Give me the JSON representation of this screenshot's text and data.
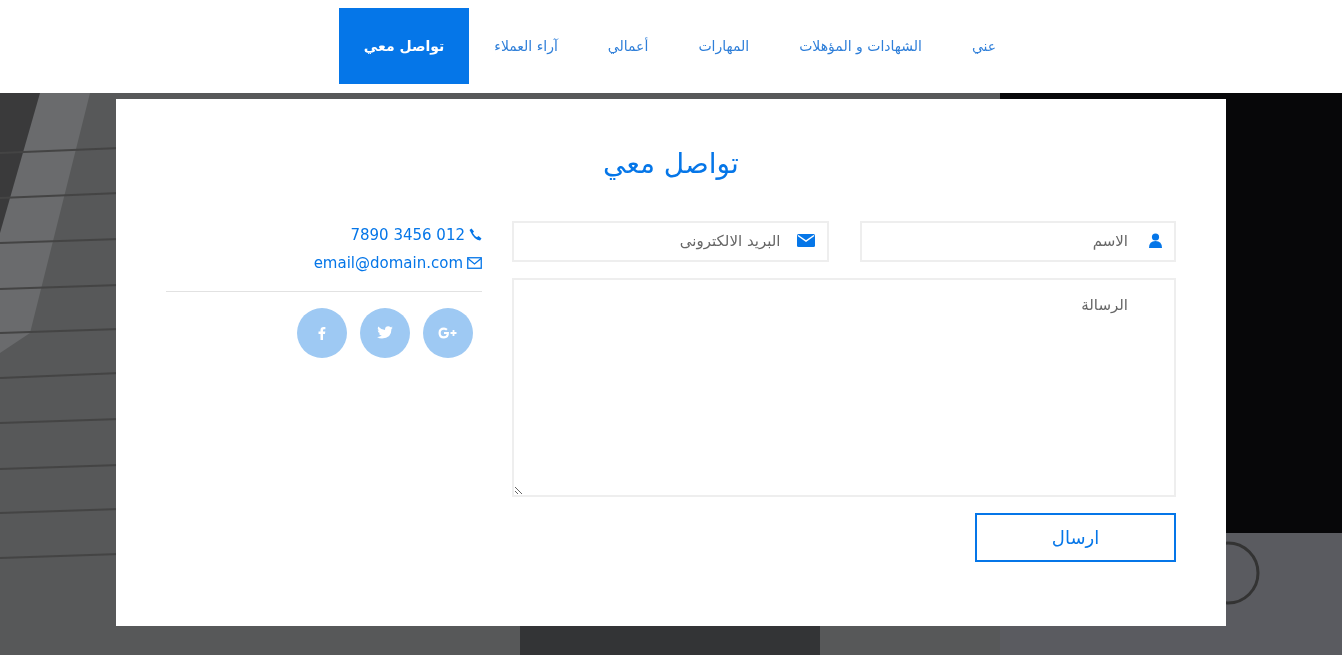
{
  "nav": {
    "items": [
      {
        "label": "عني",
        "selected": false
      },
      {
        "label": "الشهادات و المؤهلات",
        "selected": false
      },
      {
        "label": "المهارات",
        "selected": false
      },
      {
        "label": "أعمالي",
        "selected": false
      },
      {
        "label": "آراء العملاء",
        "selected": false
      },
      {
        "label": "تواصل معي",
        "selected": true
      }
    ]
  },
  "contact": {
    "title": "تواصل معي",
    "form": {
      "name_field": {
        "placeholder": "الاسم"
      },
      "email_field": {
        "placeholder": "البريد الالكترونى"
      },
      "message_field": {
        "placeholder": "الرسالة"
      },
      "submit_button": "ارسال"
    },
    "info": {
      "phone": "7890 3456 012",
      "email": "email@domain.com"
    },
    "social": [
      {
        "kind": "google-plus"
      },
      {
        "kind": "twitter"
      },
      {
        "kind": "facebook"
      }
    ]
  }
}
